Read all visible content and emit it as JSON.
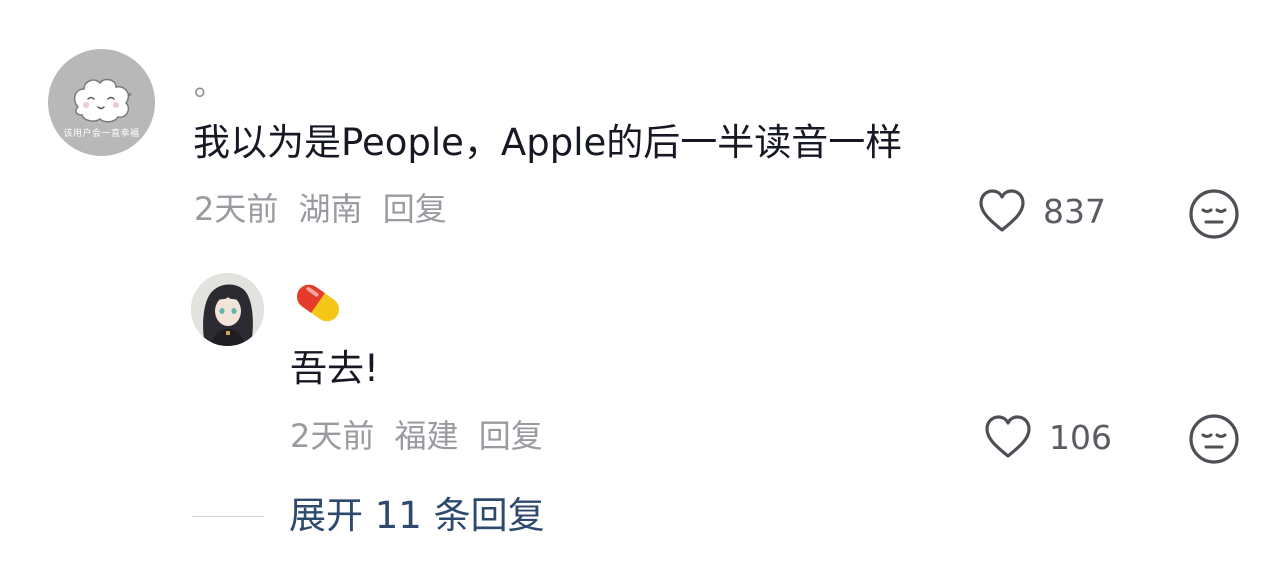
{
  "main_comment": {
    "avatar_caption": "该用户会一直幸福",
    "username": "。",
    "text": "我以为是People，Apple的后一半读音一样",
    "time": "2天前",
    "location": "湖南",
    "reply_label": "回复",
    "like_count": "837",
    "icons": {
      "like": "heart-icon",
      "dislike": "neutral-face-icon"
    }
  },
  "reply_comment": {
    "username_icon": "pill-emoji",
    "text": "吾去!",
    "time": "2天前",
    "location": "福建",
    "reply_label": "回复",
    "like_count": "106",
    "icons": {
      "like": "heart-icon",
      "dislike": "neutral-face-icon"
    }
  },
  "expand": {
    "label": "展开 11 条回复"
  },
  "colors": {
    "text_primary": "#161823",
    "text_secondary": "#9a9ba1",
    "link": "#2d4a6e",
    "pill_red": "#e53b2c",
    "pill_yellow": "#f5c518"
  }
}
